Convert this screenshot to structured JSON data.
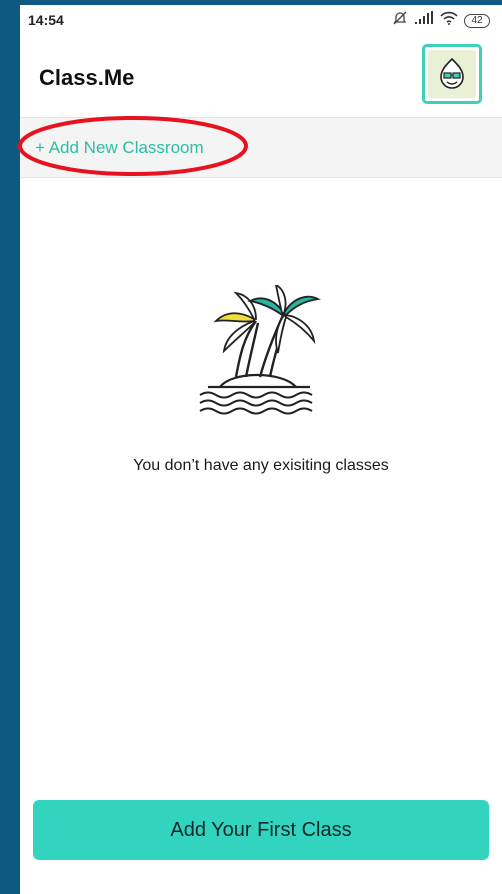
{
  "status_bar": {
    "time": "14:54",
    "battery": "42",
    "icons": [
      "mute-icon",
      "signal-icon",
      "wifi-icon",
      "battery-icon"
    ]
  },
  "header": {
    "title": "Class.Me",
    "avatar_icon": "avatar-face-with-glasses-icon"
  },
  "add_bar": {
    "label": "+ Add New Classroom"
  },
  "empty_state": {
    "illustration": "palm-island-icon",
    "message": "You don’t have any exisiting classes"
  },
  "primary_button": {
    "label": "Add Your First Class"
  },
  "colors": {
    "accent": "#33d4bf",
    "link": "#2bbfa2",
    "annotation": "#e8121f",
    "frame": "#0f5880"
  }
}
